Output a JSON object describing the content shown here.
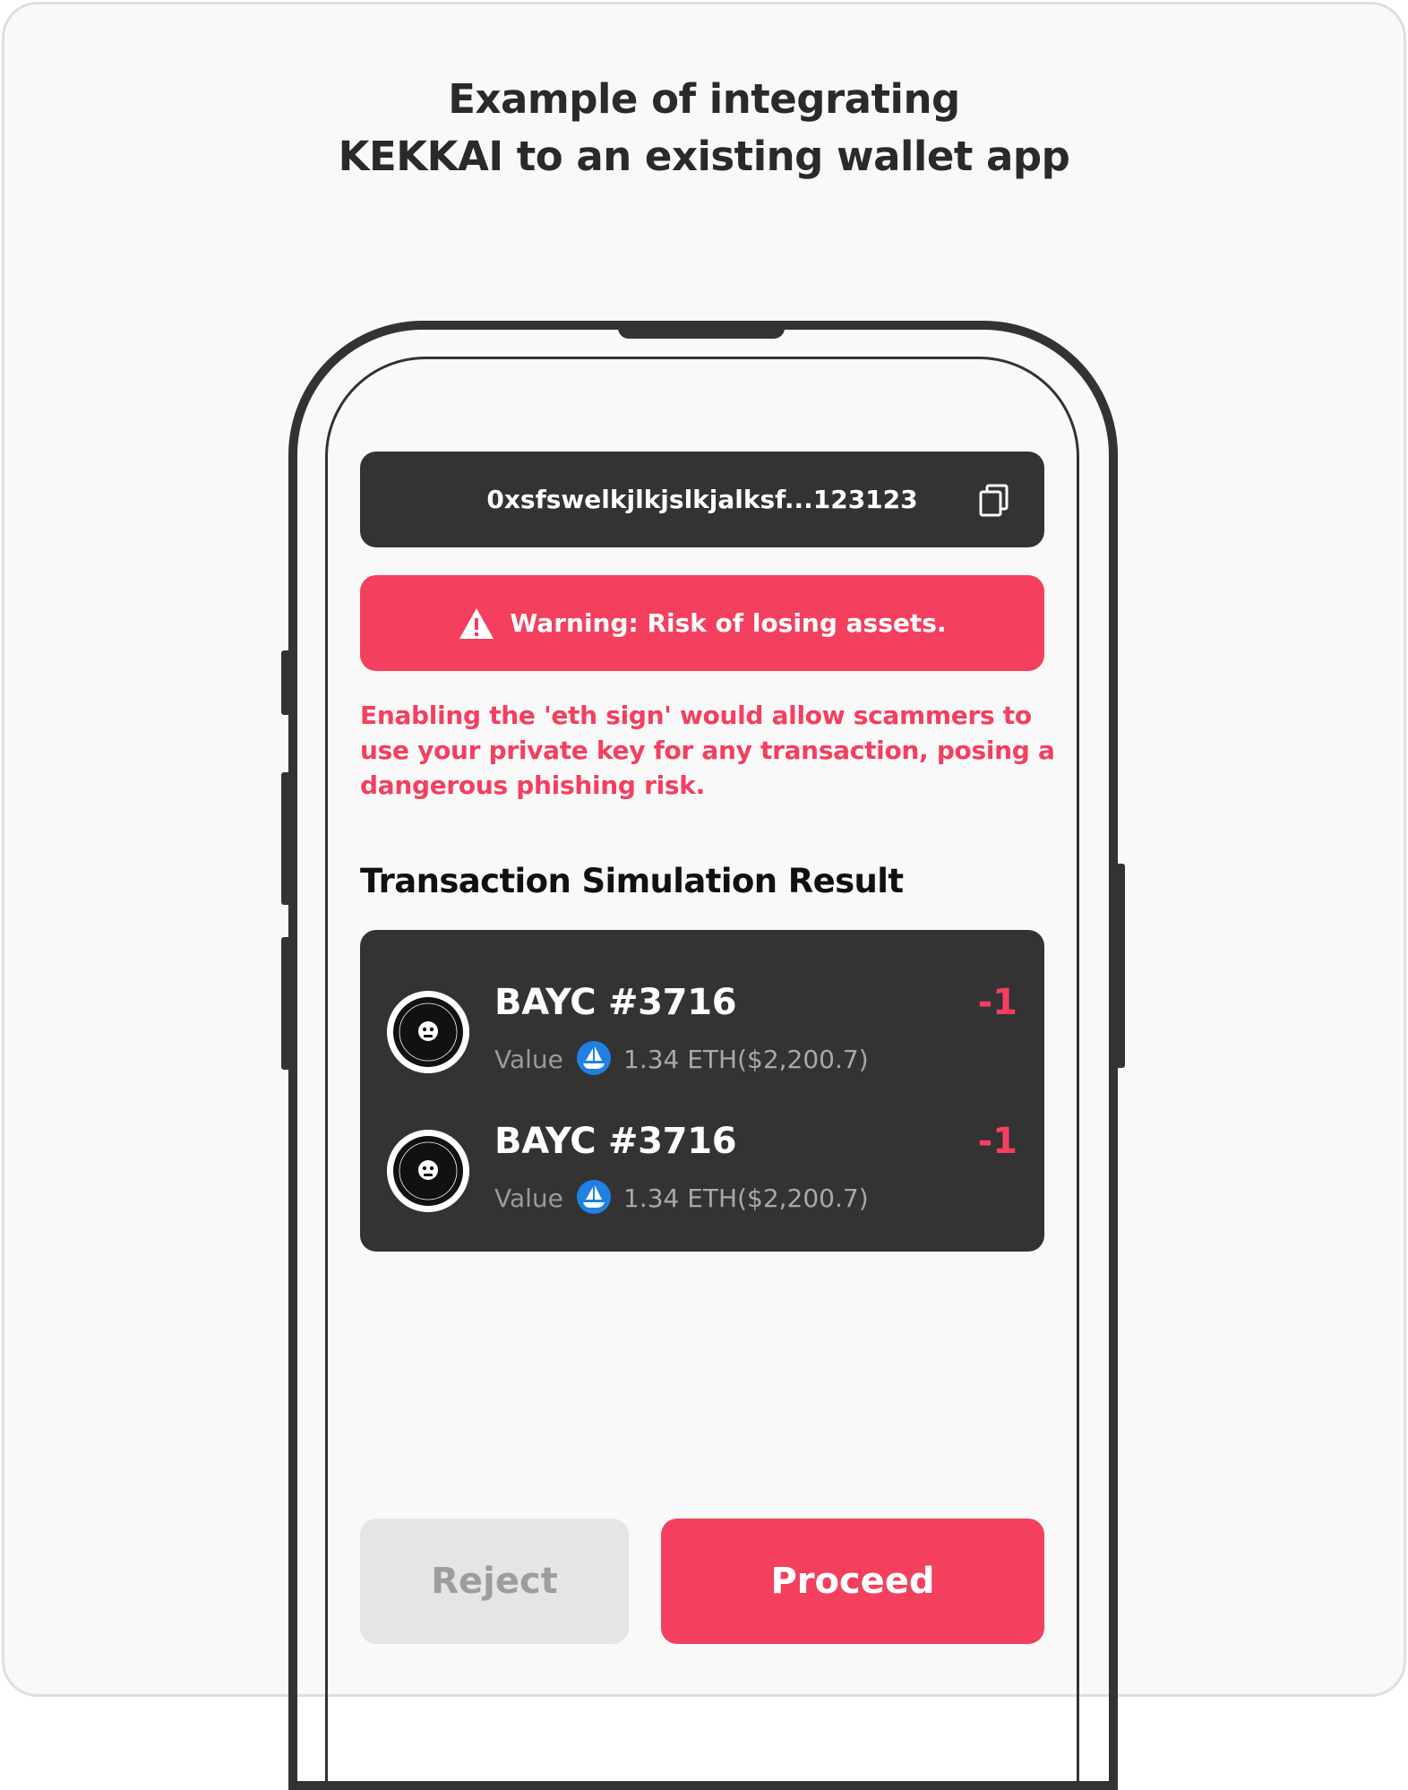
{
  "header": {
    "line1": "Example of integrating",
    "line2": "KEKKAI to an existing wallet app"
  },
  "wallet": {
    "address": "0xsfswelkjlkjslkjalksf...123123"
  },
  "warning": {
    "text": "Warning: Risk of losing assets.",
    "description": "Enabling the 'eth sign' would allow scammers to use your private key for any transaction, posing a dangerous phishing risk."
  },
  "simulation": {
    "title": "Transaction Simulation Result",
    "items": [
      {
        "name": "BAYC #3716",
        "value_label": "Value",
        "value": "1.34 ETH($2,200.7)",
        "delta": "-1"
      },
      {
        "name": "BAYC #3716",
        "value_label": "Value",
        "value": "1.34 ETH($2,200.7)",
        "delta": "-1"
      }
    ]
  },
  "actions": {
    "reject_label": "Reject",
    "proceed_label": "Proceed"
  },
  "icons": {
    "copy": "copy-icon",
    "warning": "warning-triangle-icon",
    "nft_avatar": "bayc-logo-icon",
    "marketplace": "opensea-icon"
  },
  "colors": {
    "accent": "#f43f5e",
    "dark": "#333333",
    "background": "#f9f9f9"
  }
}
